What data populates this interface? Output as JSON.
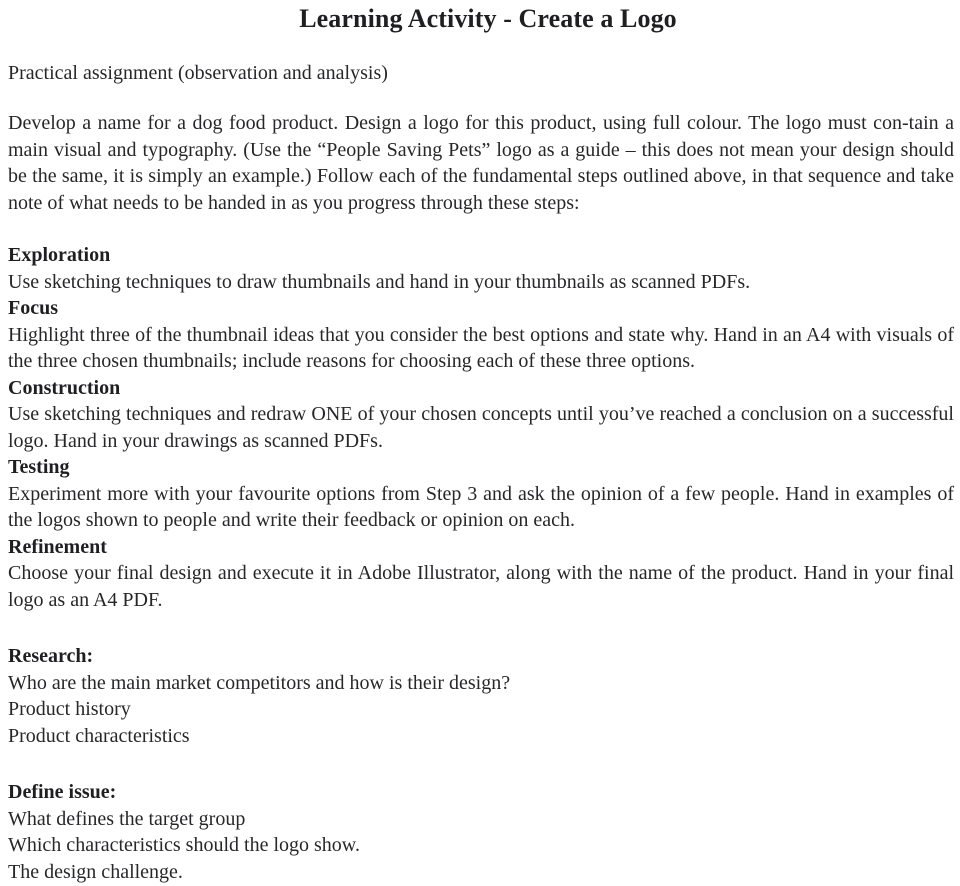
{
  "document": {
    "title": "Learning Activity - Create a Logo",
    "subtitle": "Practical assignment (observation and analysis)",
    "intro_paragraph": "Develop a name for a dog food product. Design a logo for this product, using full colour. The logo must con-tain a main visual and typography. (Use the “People Saving Pets” logo as a guide – this does not mean your design should be the same, it is simply an example.) Follow each of the fundamental steps outlined above, in that sequence and take note of what needs to be handed in as you progress through these steps:",
    "steps": [
      {
        "heading": "Exploration",
        "body": "Use sketching techniques to draw thumbnails and hand in your thumbnails as scanned PDFs."
      },
      {
        "heading": "Focus",
        "body": "Highlight three of the thumbnail ideas that you consider the best options and state why. Hand in an A4 with visuals of the three chosen thumbnails; include reasons for choosing each of these three options."
      },
      {
        "heading": "Construction",
        "body": "Use sketching techniques and redraw ONE of your chosen concepts until you’ve reached a conclusion on a successful logo. Hand in your drawings as scanned PDFs."
      },
      {
        "heading": "Testing",
        "body": "Experiment more with your favourite options from Step 3 and ask the opinion of a few people. Hand in examples of the logos shown to people and write their feedback or opinion on each."
      },
      {
        "heading": "Refinement",
        "body": "Choose your final design and execute it in Adobe Illustrator, along with the name of the product. Hand in your final logo as an A4 PDF."
      }
    ],
    "research": {
      "heading": "Research:",
      "lines": [
        "Who are the main market competitors and how is their design?",
        "Product history",
        "Product characteristics"
      ]
    },
    "define_issue": {
      "heading": "Define issue:",
      "lines": [
        "What defines the target group",
        "Which characteristics should the logo show.",
        "The design challenge."
      ]
    }
  },
  "colors": {
    "text": "#27272a",
    "heading": "#1f1f22",
    "background": "#ffffff"
  }
}
